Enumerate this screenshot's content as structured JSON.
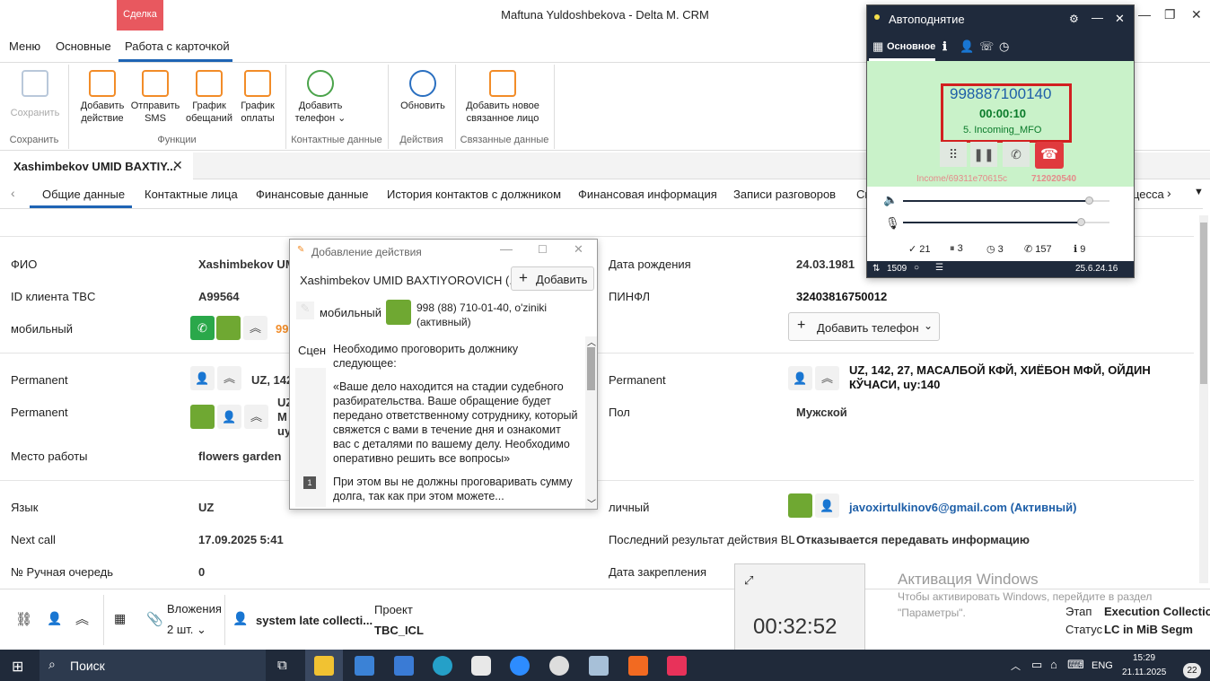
{
  "window": {
    "badge": "Сделка",
    "title": "Maftuna Yuldoshbekova - Delta M. CRM"
  },
  "menu": {
    "items": [
      "Меню",
      "Основные",
      "Работа с карточкой"
    ]
  },
  "ribbon": {
    "save": "Сохранить",
    "add_action": [
      "Добавить",
      "действие"
    ],
    "send_sms": [
      "Отправить",
      "SMS"
    ],
    "promise_schedule": [
      "График",
      "обещаний"
    ],
    "payment_schedule": [
      "График",
      "оплаты"
    ],
    "add_phone": [
      "Добавить",
      "телефон"
    ],
    "refresh": "Обновить",
    "add_related": [
      "Добавить новое",
      "связанное лицо"
    ],
    "groups": {
      "save": "Сохранить",
      "functions": "Функции",
      "contact_data": "Контактные данные",
      "actions": "Действия",
      "related": "Связанные данные"
    }
  },
  "doctab": {
    "title": "Xashimbekov UMID BAXTIY..."
  },
  "section_tabs": [
    "Общие данные",
    "Контактные лица",
    "Финансовые данные",
    "История контактов с должником",
    "Финансовая информация",
    "Записи разговоров",
    "Сп",
    "цесса"
  ],
  "form": {
    "left": [
      {
        "label": "ФИО",
        "value": "Xashimbekov UM"
      },
      {
        "label": "ID клиента TBC",
        "value": "A99564"
      },
      {
        "label": "мобильный",
        "value": "99"
      },
      {
        "label": "Permanent",
        "value": "UZ, 142"
      },
      {
        "label": "Permanent",
        "value": "UZ\nM\nuy"
      },
      {
        "label": "Место работы",
        "value": "flowers garden"
      },
      {
        "label": "Язык",
        "value": "UZ"
      },
      {
        "label": "Next call",
        "value": "17.09.2025 5:41"
      },
      {
        "label": "№ Ручная очередь",
        "value": "0"
      }
    ],
    "right": [
      {
        "label": "Дата рождения",
        "value": "24.03.1981"
      },
      {
        "label": "ПИНФЛ",
        "value": "32403816750012"
      },
      {
        "label": "Permanent",
        "value": "UZ, 142, 27, МАСАЛБОЙ КФЙ, ХИЁБОН МФЙ, ОЙДИН КЎЧАСИ,  uy:140"
      },
      {
        "label": "Пол",
        "value": "Мужской"
      },
      {
        "label": "личный",
        "value": "javoxirtulkinov6@gmail.com (Активный)"
      },
      {
        "label": "Последний результат действия BL",
        "value": "Отказывается передавать информацию"
      },
      {
        "label": "Дата закрепления",
        "value": ""
      }
    ],
    "add_phone_btn": "Добавить телефон"
  },
  "dialog": {
    "title": "Добавление действия",
    "person": "Xashimbekov UMID BAXTIYOROVICH (...",
    "add_btn": "Добавить",
    "phone_type": "мобильный",
    "phone_value": "998 (88) 710-01-40, o'ziniki (активный)",
    "scenario_label": "Сцен",
    "script_p1": "Необходимо проговорить должнику следующее:",
    "script_p2": "«Ваше дело находится на стадии судебного разбирательства. Ваше обращение будет передано ответственному сотруднику, который свяжется с вами в течение дня и ознакомит вас с деталями по вашему делу. Необходимо оперативно решить все вопросы»",
    "script_p3": "При этом вы не должны проговаривать сумму",
    "script_p4": "долга, так как при этом можете...",
    "row_num": "1"
  },
  "phone": {
    "title": "Автоподнятие",
    "tab_main": "Основное",
    "number": "998887100140",
    "duration": "00:00:10",
    "queue": "5. Incoming_MFO",
    "call_id": "Income/69311e70615c",
    "ext": "712020540",
    "volume_level": 0.9,
    "mic_level": 0.86,
    "stats": [
      "21",
      "3",
      "3",
      "157",
      "9"
    ],
    "footer_left": "1509",
    "version": "25.6.24.16"
  },
  "bottom": {
    "attachments_label": "Вложения",
    "attachments_count": "2 шт.",
    "operator": "system late collecti...",
    "project_label": "Проект",
    "project_value": "TBC_ICL",
    "stage_label": "Этап",
    "stage_value": "Execution Collection",
    "status_label": "Статус",
    "status_value": "LC in MiB Segm"
  },
  "timer": {
    "value": "00:32:52"
  },
  "watermark": {
    "title": "Активация Windows",
    "line1": "Чтобы активировать Windows, перейдите в раздел",
    "line2": "\"Параметры\"."
  },
  "taskbar": {
    "search": "Поиск",
    "lang": "ENG",
    "time": "15:29",
    "date": "21.11.2025",
    "notifications": "22"
  },
  "colors": {
    "accent": "#1e64b4",
    "green": "#6fa832",
    "call_bg": "#c9f2c9",
    "red": "#e03a3e",
    "deal_badge": "#e8585f"
  }
}
